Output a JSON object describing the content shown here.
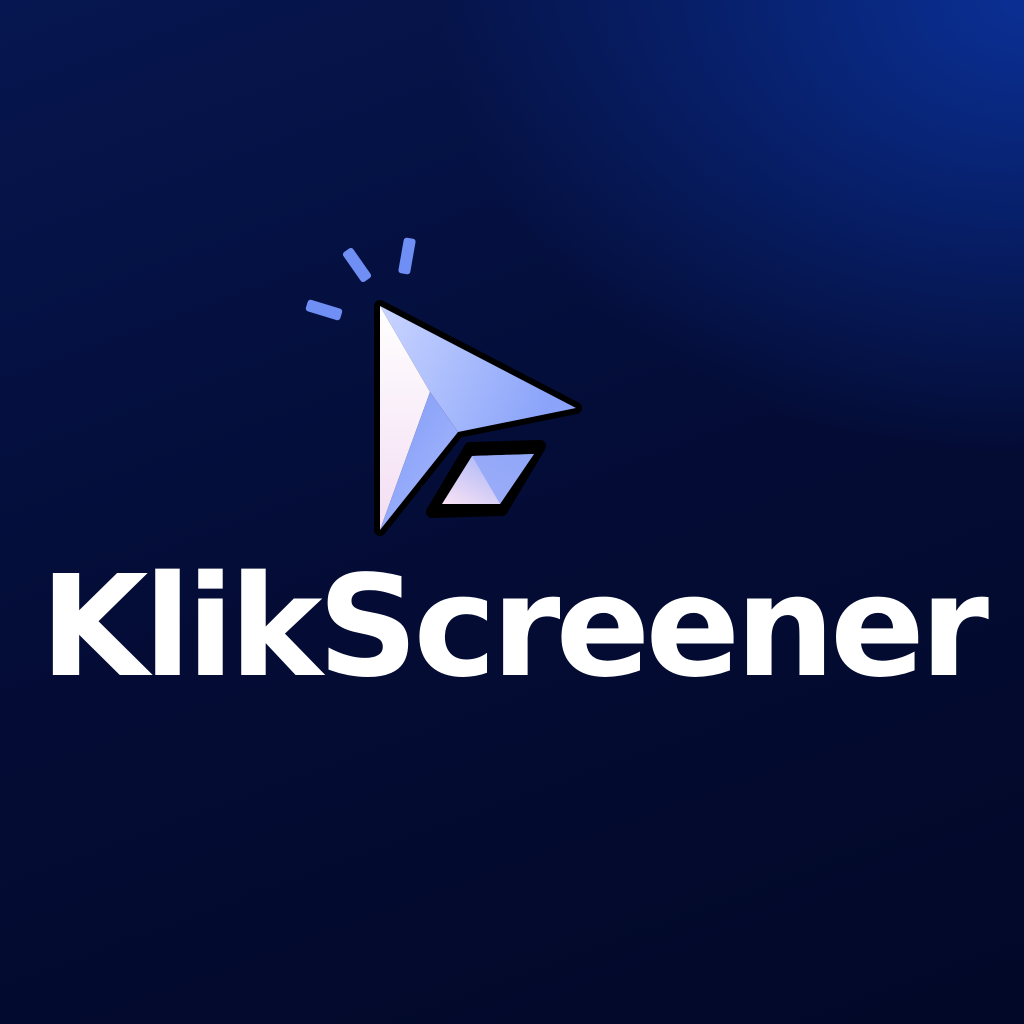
{
  "brand": {
    "name": "KlikScreener"
  },
  "icons": {
    "logo": "cursor-click-icon",
    "sparkles": "click-sparkle-icon"
  },
  "colors": {
    "background_dark": "#030a2e",
    "background_glow": "#0a2f94",
    "accent_blue": "#6f8ff5",
    "accent_pink": "#fde4f2",
    "outline": "#000000",
    "wordmark": "#ffffff"
  }
}
